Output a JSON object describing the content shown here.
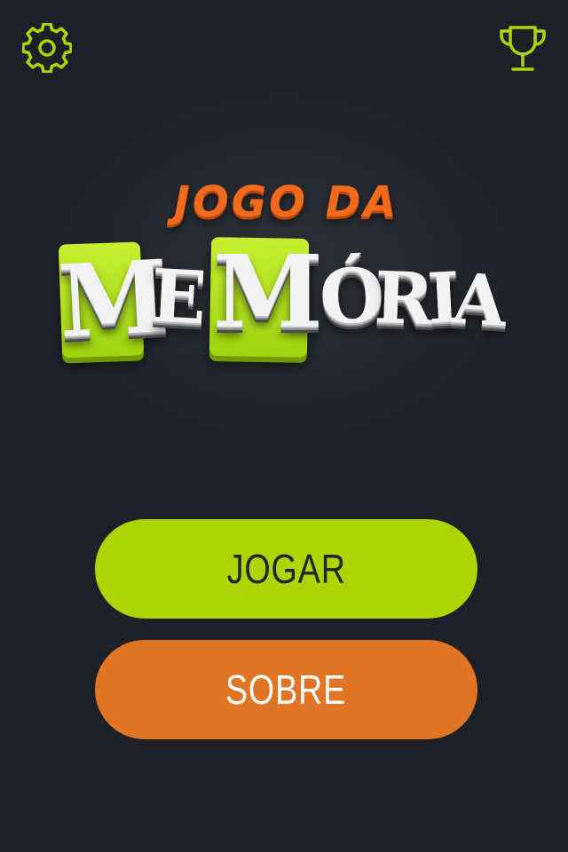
{
  "header": {
    "settings_icon": "gear-icon",
    "trophy_icon": "trophy-icon",
    "icon_color": "#acd503"
  },
  "logo": {
    "line1": "JOGO DA",
    "letters": [
      "M",
      "E",
      "M",
      "Ó",
      "R",
      "I",
      "A"
    ],
    "line1_color": "#f26a1b",
    "tile_color": "#acd503"
  },
  "menu": {
    "play_label": "JOGAR",
    "about_label": "SOBRE",
    "play_color": "#acd503",
    "about_color": "#e07526"
  },
  "colors": {
    "background": "#1d2026"
  }
}
